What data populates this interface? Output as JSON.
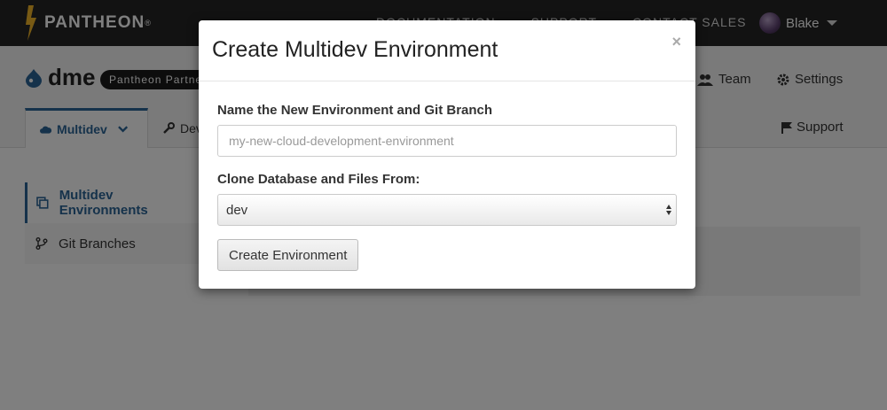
{
  "topnav": {
    "brand": "PANTHEON",
    "brand_mark": "®",
    "links": [
      "DOCUMENTATION",
      "SUPPORT",
      "CONTACT SALES"
    ],
    "user_name": "Blake"
  },
  "site": {
    "name": "dme",
    "badge": "Pantheon Partner",
    "header_links": {
      "team": "Team",
      "settings": "Settings"
    },
    "tabs": {
      "multidev": "Multidev",
      "dev": "Dev"
    },
    "support": "Support"
  },
  "sidebar": {
    "items": [
      {
        "label": "Multidev Environments"
      },
      {
        "label": "Git Branches"
      }
    ]
  },
  "modal": {
    "title": "Create Multidev Environment",
    "close": "×",
    "name_label": "Name the New Environment and Git Branch",
    "name_placeholder": "my-new-cloud-development-environment",
    "clone_label": "Clone Database and Files From:",
    "clone_value": "dev",
    "submit": "Create Environment"
  },
  "colors": {
    "accent": "#2a6496",
    "brand_bolt": "#f0b429",
    "overlay": "rgba(0,0,0,0.5)"
  }
}
